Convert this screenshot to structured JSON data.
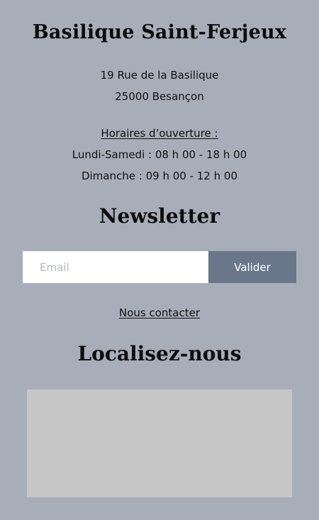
{
  "venue": {
    "name": "Basilique Saint-Ferjeux",
    "address_line1": "19 Rue de la Basilique",
    "address_line2": "25000 Besançon"
  },
  "hours": {
    "title": "Horaires d’ouverture :",
    "weekdays": "Lundi-Samedi : 08 h 00 - 18 h 00",
    "sunday": "Dimanche : 09 h 00 - 12 h 00"
  },
  "newsletter": {
    "title": "Newsletter",
    "email_placeholder": "Email",
    "email_value": "",
    "submit_label": "Valider"
  },
  "contact": {
    "link_label": "Nous contacter"
  },
  "location": {
    "title": "Localisez-nous"
  },
  "colors": {
    "background": "#a8aeb9",
    "button": "#6a7689",
    "map_placeholder": "#c6c6c6"
  }
}
